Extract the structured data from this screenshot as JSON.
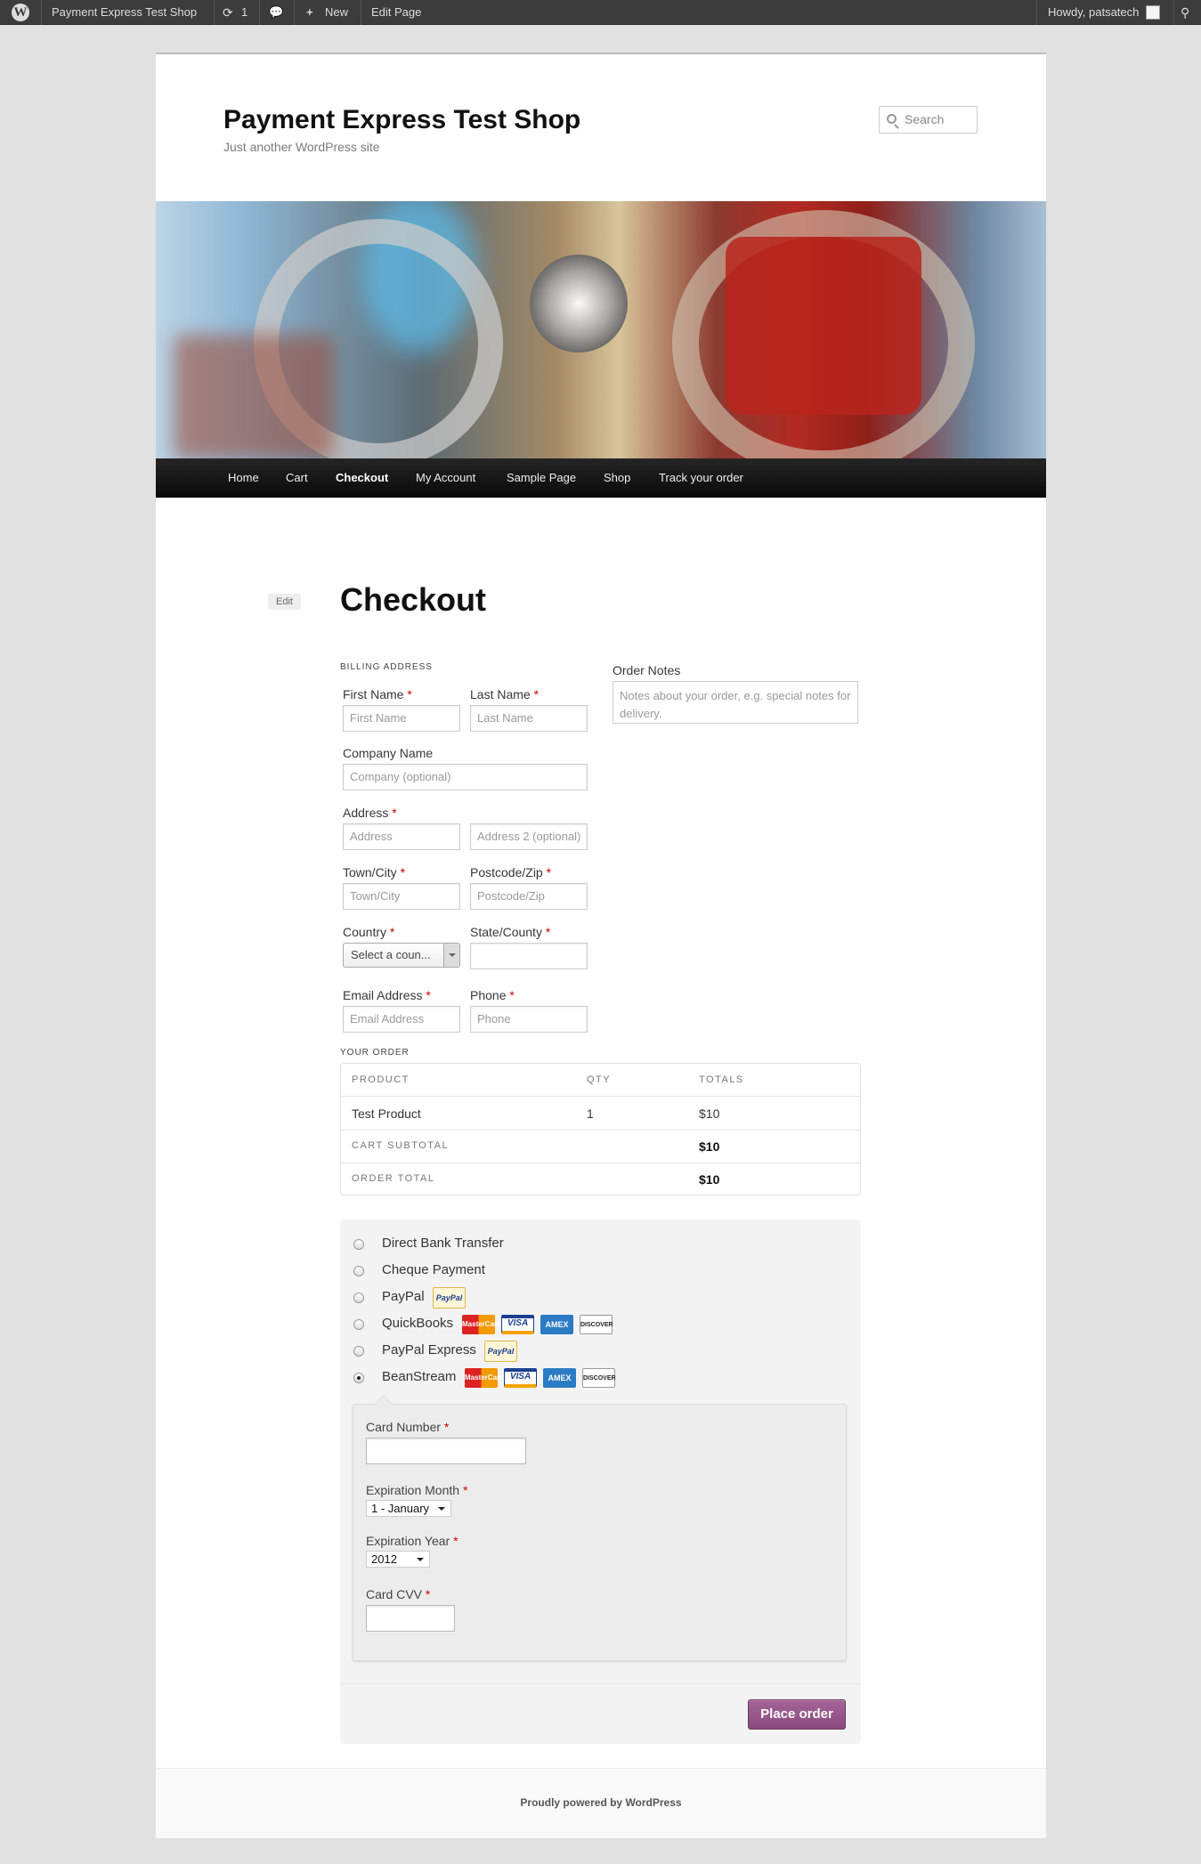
{
  "adminbar": {
    "site_name": "Payment Express Test Shop",
    "updates": "1",
    "new_label": "New",
    "edit_page": "Edit Page",
    "howdy": "Howdy, patsatech"
  },
  "site": {
    "title": "Payment Express Test Shop",
    "description": "Just another WordPress site",
    "search_placeholder": "Search"
  },
  "nav": {
    "items": [
      "Home",
      "Cart",
      "Checkout",
      "My Account",
      "Sample Page",
      "Shop",
      "Track your order"
    ],
    "current": "Checkout"
  },
  "page": {
    "edit_label": "Edit",
    "title": "Checkout"
  },
  "billing": {
    "heading": "BILLING ADDRESS",
    "first_name": {
      "label": "First Name",
      "placeholder": "First Name"
    },
    "last_name": {
      "label": "Last Name",
      "placeholder": "Last Name"
    },
    "company": {
      "label": "Company Name",
      "placeholder": "Company (optional)"
    },
    "address": {
      "label": "Address",
      "placeholder": "Address",
      "placeholder2": "Address 2 (optional)"
    },
    "city": {
      "label": "Town/City",
      "placeholder": "Town/City"
    },
    "postcode": {
      "label": "Postcode/Zip",
      "placeholder": "Postcode/Zip"
    },
    "country": {
      "label": "Country",
      "value": "Select a coun..."
    },
    "state": {
      "label": "State/County",
      "placeholder": ""
    },
    "email": {
      "label": "Email Address",
      "placeholder": "Email Address"
    },
    "phone": {
      "label": "Phone",
      "placeholder": "Phone"
    },
    "required_mark": "*"
  },
  "notes": {
    "label": "Order Notes",
    "placeholder": "Notes about your order, e.g. special notes for delivery."
  },
  "order": {
    "heading": "YOUR ORDER",
    "headers": {
      "product": "PRODUCT",
      "qty": "QTY",
      "totals": "TOTALS"
    },
    "item": {
      "product": "Test Product",
      "qty": "1",
      "total": "$10"
    },
    "subtotal_label": "CART SUBTOTAL",
    "subtotal_value": "$10",
    "total_label": "ORDER TOTAL",
    "total_value": "$10"
  },
  "payment": {
    "methods": [
      "Direct Bank Transfer",
      "Cheque Payment",
      "PayPal",
      "QuickBooks",
      "PayPal Express",
      "BeanStream"
    ],
    "selected": "BeanStream",
    "card_labels": {
      "mastercard": "MasterCard",
      "visa": "VISA",
      "amex": "AMEX",
      "discover": "DISCOVER",
      "paypal": "PayPal"
    },
    "card_number_label": "Card Number",
    "exp_month_label": "Expiration Month",
    "exp_month_value": "1 - January",
    "exp_year_label": "Expiration Year",
    "exp_year_value": "2012",
    "cvv_label": "Card CVV",
    "place_order": "Place order"
  },
  "footer": {
    "text": "Proudly powered by WordPress"
  },
  "colors": {
    "adminbar_bg": "#3c3c3c",
    "nav_bg": "#1a1a1a",
    "place_order_bg": "#a46497",
    "required": "#cc0000"
  }
}
